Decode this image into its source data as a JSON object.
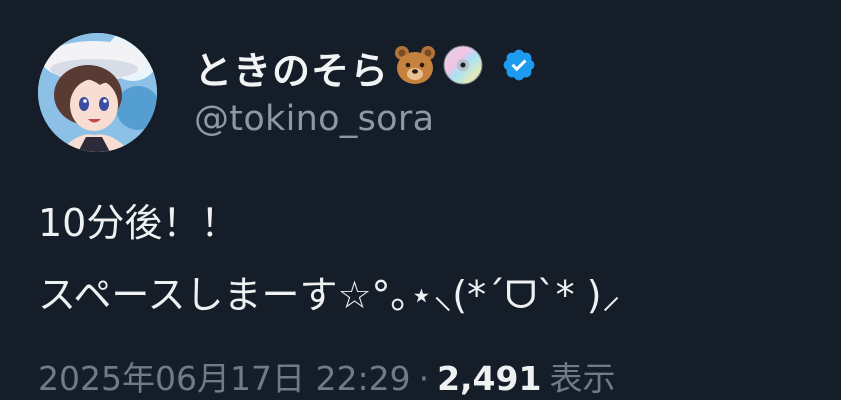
{
  "author": {
    "display_name": "ときのそら",
    "emojis": [
      "bear-face-icon",
      "optical-disc-icon"
    ],
    "verified_icon": "verified-badge-icon",
    "handle": "@tokino_sora"
  },
  "post": {
    "line1": "10分後！！",
    "line2": "スペースしまーす☆°｡⋆⸜(*ˊᗜˋ* )⸝"
  },
  "meta": {
    "timestamp": "2025年06月17日 22:29",
    "separator": "·",
    "views_count": "2,491",
    "views_label": "表示"
  },
  "colors": {
    "background": "#151d28",
    "verified": "#1d9bf0",
    "secondary_text": "#8b98a5"
  }
}
